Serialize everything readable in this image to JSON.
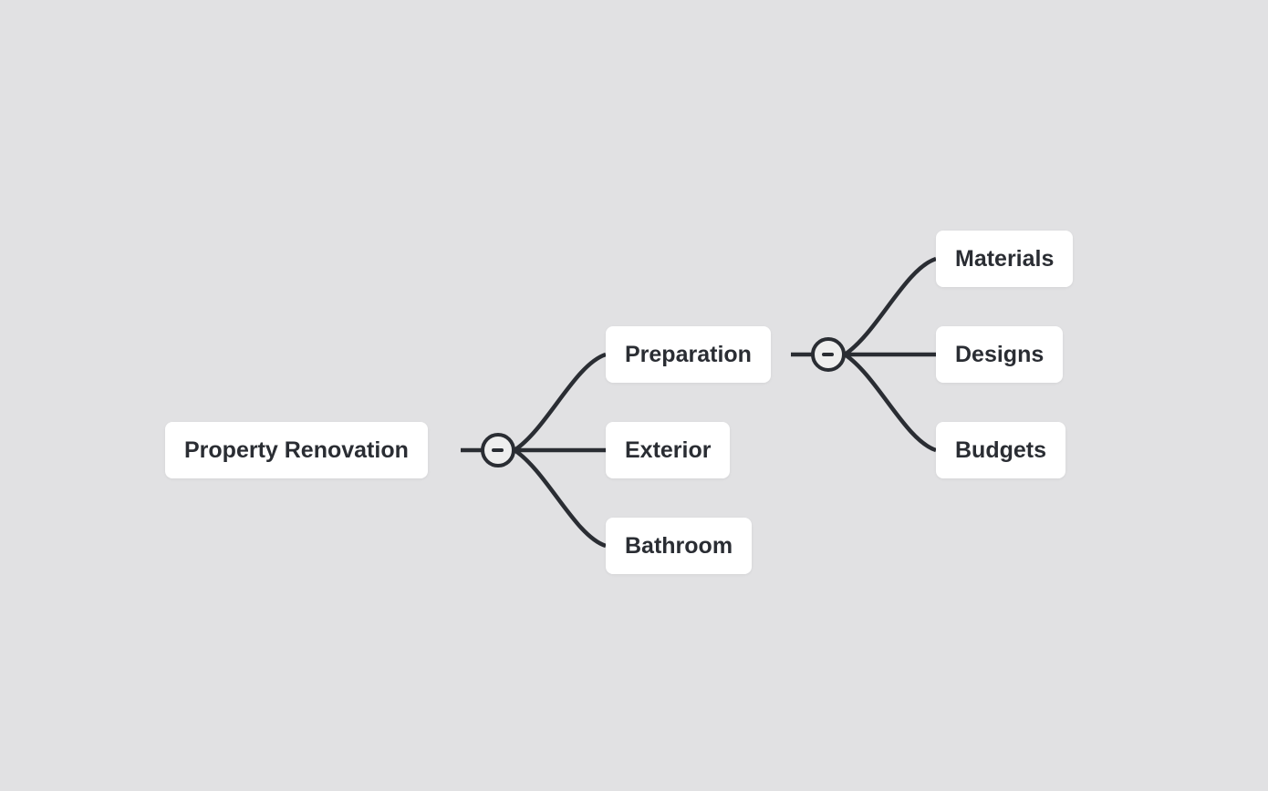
{
  "mindmap": {
    "root": {
      "label": "Property Renovation",
      "collapse_icon": "minus-circle-icon",
      "children": [
        {
          "label": "Preparation",
          "collapse_icon": "minus-circle-icon",
          "children": [
            {
              "label": "Materials"
            },
            {
              "label": "Designs"
            },
            {
              "label": "Budgets"
            }
          ]
        },
        {
          "label": "Exterior"
        },
        {
          "label": "Bathroom"
        }
      ]
    }
  },
  "colors": {
    "background": "#eeeeee",
    "grid_dot": "#e1e1e3",
    "node_fill": "#ffffff",
    "line": "#2a2d33",
    "text": "#2a2d33"
  }
}
